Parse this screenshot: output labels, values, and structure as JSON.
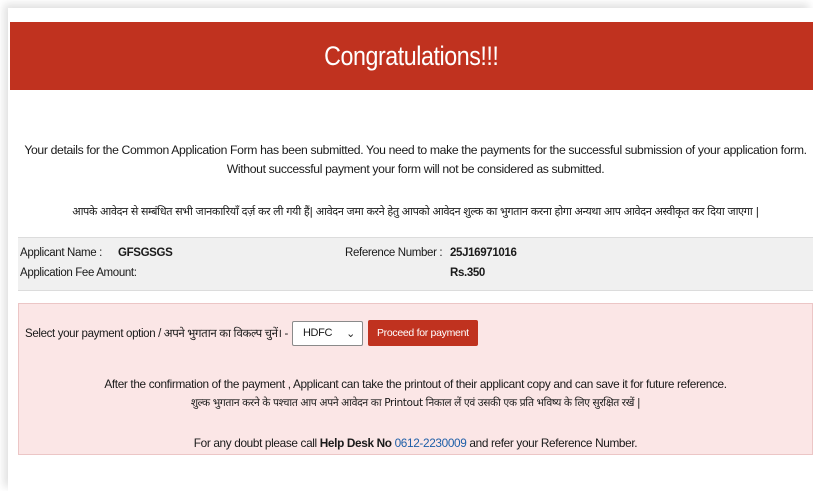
{
  "banner": {
    "title": "Congratulations!!!"
  },
  "intro": {
    "english": "Your details for the Common Application Form has been submitted. You need to make the payments for the successful submission of your application form. Without successful payment your form will not be considered as submitted.",
    "hindi": "आपके आवेदन से सम्बंधित सभी जानकारियाँ दर्ज़ कर ली गयी हैं| आवेदन जमा करने हेतु आपको आवेदन शुल्क का भुगतान करना होगा अन्यथा आप आवेदन अस्वीकृत कर दिया जाएगा |"
  },
  "details": {
    "applicant_name_label": "Applicant Name :",
    "applicant_name_value": "GFSGSGS",
    "fee_label": "Application Fee Amount:",
    "reference_label": "Reference Number :",
    "reference_value": "25J16971016",
    "fee_value": "Rs.350"
  },
  "payment": {
    "option_label": "Select your payment option / अपने भुगतान का विकल्प चुनें। -",
    "selected_option": "HDFC",
    "proceed_button": "Proceed for payment",
    "note_english": "After the confirmation of the payment , Applicant can take the printout of their applicant copy and can save it for future reference.",
    "note_hindi": "शुल्क भुगतान करने के पश्चात आप अपने आवेदन का Printout निकाल लें एवं उसकी एक प्रति भविष्य के लिए सुरक्षित रखें |",
    "help_prefix": "For any doubt please call ",
    "help_desk": "Help Desk No",
    "help_phone": "0612-2230009",
    "help_suffix": " and refer your Reference Number."
  },
  "colors": {
    "banner": "#c0321f",
    "payment_bg": "#fbe6e6",
    "details_bg": "#f0f0f0",
    "link": "#1f5fa8"
  },
  "icons": {
    "select_chevron": "chevron-down-icon"
  }
}
